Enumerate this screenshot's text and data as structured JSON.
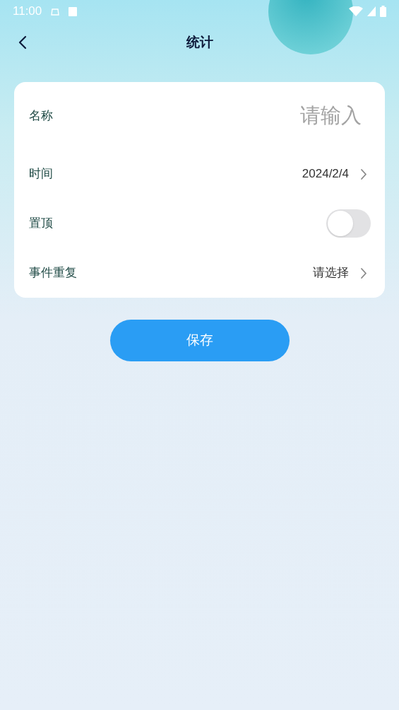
{
  "status_bar": {
    "time": "11:00"
  },
  "header": {
    "title": "统计"
  },
  "form": [
    {
      "kind": "input",
      "label": "名称",
      "placeholder": "请输入"
    },
    {
      "kind": "select",
      "label": "时间",
      "value": "2024/2/4"
    },
    {
      "kind": "toggle",
      "label": "置顶",
      "on": false
    },
    {
      "kind": "select",
      "label": "事件重复",
      "value": "请选择"
    }
  ],
  "save_button": "保存"
}
